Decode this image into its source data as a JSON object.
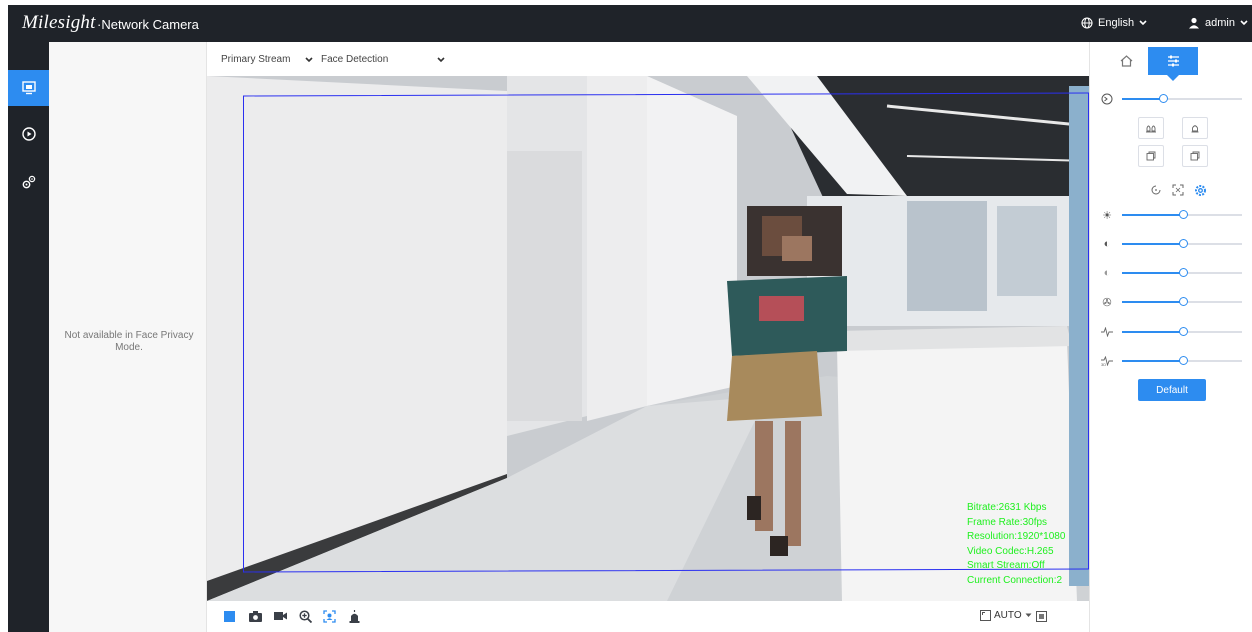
{
  "header": {
    "brand": "Milesight",
    "subtitle": "·Network Camera",
    "language": "English",
    "user": "admin"
  },
  "nav": {
    "items": [
      "live-view",
      "playback",
      "settings"
    ],
    "active": "live-view"
  },
  "stream": {
    "stream_select": "Primary Stream",
    "mode_select": "Face Detection"
  },
  "left_panel": {
    "notice": "Not available in Face Privacy Mode."
  },
  "osd": {
    "lines": [
      "Bitrate:2631 Kbps",
      "Frame Rate:30fps",
      "Resolution:1920*1080",
      "Video Codec:H.265",
      "Smart Stream:Off",
      "Current Connection:2"
    ]
  },
  "toolbar": {
    "zoom_mode": "AUTO"
  },
  "image_panel": {
    "default_label": "Default",
    "sliders": [
      {
        "name": "zoom",
        "level": 0.34
      },
      {
        "name": "brightness",
        "level": 0.51
      },
      {
        "name": "contrast",
        "level": 0.51
      },
      {
        "name": "saturation",
        "level": 0.51
      },
      {
        "name": "sharpness",
        "level": 0.51
      },
      {
        "name": "noise-reduction",
        "level": 0.51
      },
      {
        "name": "dnr",
        "level": 0.51
      }
    ]
  },
  "colors": {
    "accent": "#2d8cf0",
    "topbar": "#1f2329",
    "osd": "#1ef01e",
    "detect_box": "#2a2ff0"
  }
}
